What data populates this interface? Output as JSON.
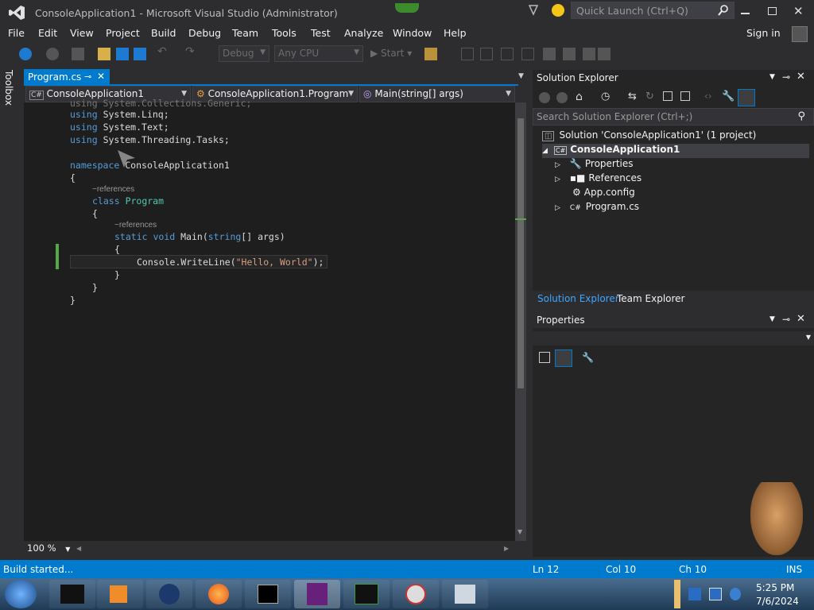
{
  "window": {
    "title": "ConsoleApplication1 - Microsoft Visual Studio (Administrator)",
    "quick_launch_placeholder": "Quick Launch (Ctrl+Q)",
    "sign_in": "Sign in"
  },
  "menu": [
    "File",
    "Edit",
    "View",
    "Project",
    "Build",
    "Debug",
    "Team",
    "Tools",
    "Test",
    "Analyze",
    "Window",
    "Help"
  ],
  "toolbar": {
    "config": "Debug",
    "platform": "Any CPU",
    "start": "Start"
  },
  "toolbox_label": "Toolbox",
  "editor": {
    "tab": "Program.cs",
    "nav_project": "ConsoleApplication1",
    "nav_class": "ConsoleApplication1.Program",
    "nav_member": "Main(string[] args)",
    "zoom": "100 %",
    "lines": {
      "using1": "using System.Collections.Generic;",
      "using2_kw": "using",
      "using2": "System.Linq;",
      "using3_kw": "using",
      "using3": "System.Text;",
      "using4_kw": "using",
      "using4": "System.Threading.Tasks;",
      "ns_kw": "namespace",
      "ns_name": "ConsoleApplication1",
      "brace_open": "{",
      "refs1": "−references",
      "class_kw": "class",
      "class_name": "Program",
      "brace_open2": "{",
      "refs2": "−references",
      "main_kw1": "static",
      "main_kw2": "void",
      "main_name": "Main(",
      "main_kw3": "string",
      "main_rest": "[] args)",
      "brace_open3": "{",
      "stmt_a": "Console.WriteLine(",
      "stmt_str": "\"Hello, World\"",
      "stmt_b": ");",
      "brace_close3": "}",
      "brace_close2": "}",
      "brace_close1": "}"
    }
  },
  "solution_explorer": {
    "title": "Solution Explorer",
    "search_placeholder": "Search Solution Explorer (Ctrl+;)",
    "solution": "Solution 'ConsoleApplication1' (1 project)",
    "project": "ConsoleApplication1",
    "items": [
      "Properties",
      "References",
      "App.config",
      "Program.cs"
    ],
    "tabs": [
      "Solution Explorer",
      "Team Explorer"
    ]
  },
  "properties": {
    "title": "Properties"
  },
  "status": {
    "message": "Build started...",
    "ln": "Ln 12",
    "col": "Col 10",
    "ch": "Ch 10",
    "ins": "INS"
  },
  "taskbar": {
    "time": "5:25 PM",
    "date": "7/6/2024"
  },
  "colors": {
    "accent": "#007acc",
    "keyword": "#569cd6",
    "type": "#4ec9b0",
    "string": "#d69d85"
  }
}
